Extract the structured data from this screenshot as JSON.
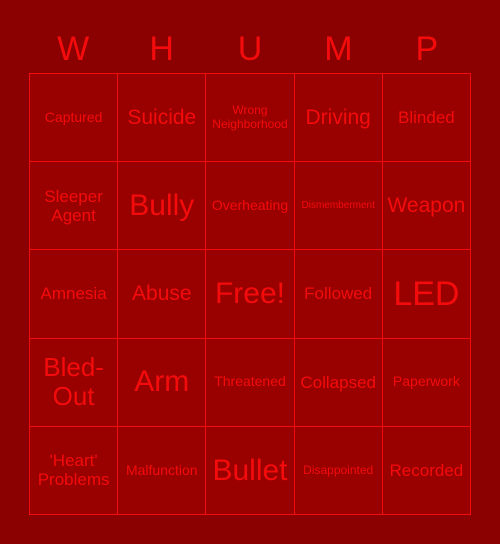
{
  "card": {
    "title": "WHUMP",
    "colors": {
      "background": "#8b0000",
      "cell_fill": "#990000",
      "grid_line": "#f40c0c",
      "text": "#f40c0c"
    },
    "header_letters": [
      "W",
      "H",
      "U",
      "M",
      "P"
    ],
    "grid": {
      "rows": 5,
      "columns": 5,
      "free_space_index": 12,
      "cells": [
        {
          "label": "Captured",
          "size": "md"
        },
        {
          "label": "Suicide",
          "size": "xl"
        },
        {
          "label": "Wrong\nNeighborhood",
          "size": "sm"
        },
        {
          "label": "Driving",
          "size": "xl"
        },
        {
          "label": "Blinded",
          "size": "lg"
        },
        {
          "label": "Sleeper\nAgent",
          "size": "lg"
        },
        {
          "label": "Bully",
          "size": "3xl"
        },
        {
          "label": "Overheating",
          "size": "md"
        },
        {
          "label": "Dismemberment",
          "size": "xs"
        },
        {
          "label": "Weapon",
          "size": "xl"
        },
        {
          "label": "Amnesia",
          "size": "lg"
        },
        {
          "label": "Abuse",
          "size": "xl"
        },
        {
          "label": "Free!",
          "size": "3xl"
        },
        {
          "label": "Followed",
          "size": "lg"
        },
        {
          "label": "LED",
          "size": "4xl"
        },
        {
          "label": "Bled-\nOut",
          "size": "2xl"
        },
        {
          "label": "Arm",
          "size": "3xl"
        },
        {
          "label": "Threatened",
          "size": "md"
        },
        {
          "label": "Collapsed",
          "size": "lg"
        },
        {
          "label": "Paperwork",
          "size": "md"
        },
        {
          "label": "'Heart'\nProblems",
          "size": "lg"
        },
        {
          "label": "Malfunction",
          "size": "md"
        },
        {
          "label": "Bullet",
          "size": "3xl"
        },
        {
          "label": "Disappointed",
          "size": "sm"
        },
        {
          "label": "Recorded",
          "size": "lg"
        }
      ]
    }
  }
}
